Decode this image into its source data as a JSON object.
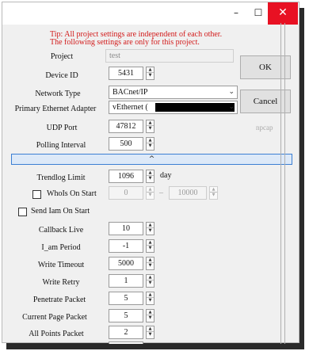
{
  "titlebar": {
    "minimize_glyph": "–",
    "maximize_glyph": "☐",
    "close_glyph": "✕"
  },
  "tips": [
    "Tip: All project settings are independent of each other.",
    "The following settings are only for this project."
  ],
  "fields": {
    "project": {
      "label": "Project",
      "value": "test"
    },
    "device_id": {
      "label": "Device ID",
      "value": "5431"
    },
    "network_type": {
      "label": "Network Type",
      "value": "BACnet/IP"
    },
    "primary_adapter": {
      "label": "Primary Ethernet Adapter",
      "value": "vEthernet ("
    },
    "udp_port": {
      "label": "UDP Port",
      "value": "47812"
    },
    "polling_interval": {
      "label": "Polling Interval",
      "value": "500"
    }
  },
  "buttons": {
    "ok": "OK",
    "cancel": "Cancel"
  },
  "npcap_label": "npcap",
  "collapse_glyph": "^",
  "advanced": {
    "trendlog_limit": {
      "label": "Trendlog Limit",
      "value": "1096",
      "unit": "day"
    },
    "whois_on_start": {
      "label": "WhoIs On Start",
      "checked": false,
      "from": "0",
      "dash": "–",
      "to": "10000"
    },
    "send_iam_on_start": {
      "label": "Send Iam On Start",
      "checked": false
    },
    "callback_live": {
      "label": "Callback Live",
      "value": "10"
    },
    "i_am_period": {
      "label": "I_am Period",
      "value": "-1"
    },
    "write_timeout": {
      "label": "Write Timeout",
      "value": "5000"
    },
    "write_retry": {
      "label": "Write Retry",
      "value": "1"
    },
    "penetrate_packet": {
      "label": "Penetrate Packet",
      "value": "5"
    },
    "current_page_packet": {
      "label": "Current Page Packet",
      "value": "5"
    },
    "all_points_packet": {
      "label": "All Points Packet",
      "value": "2"
    }
  },
  "colors": {
    "tip": "#d21a1a",
    "close": "#e81123",
    "accent": "#3c7fd3"
  },
  "icons": [
    "minimize-icon",
    "maximize-icon",
    "close-icon",
    "chevron-down-icon",
    "spin-up-icon",
    "spin-down-icon",
    "collapse-icon"
  ]
}
